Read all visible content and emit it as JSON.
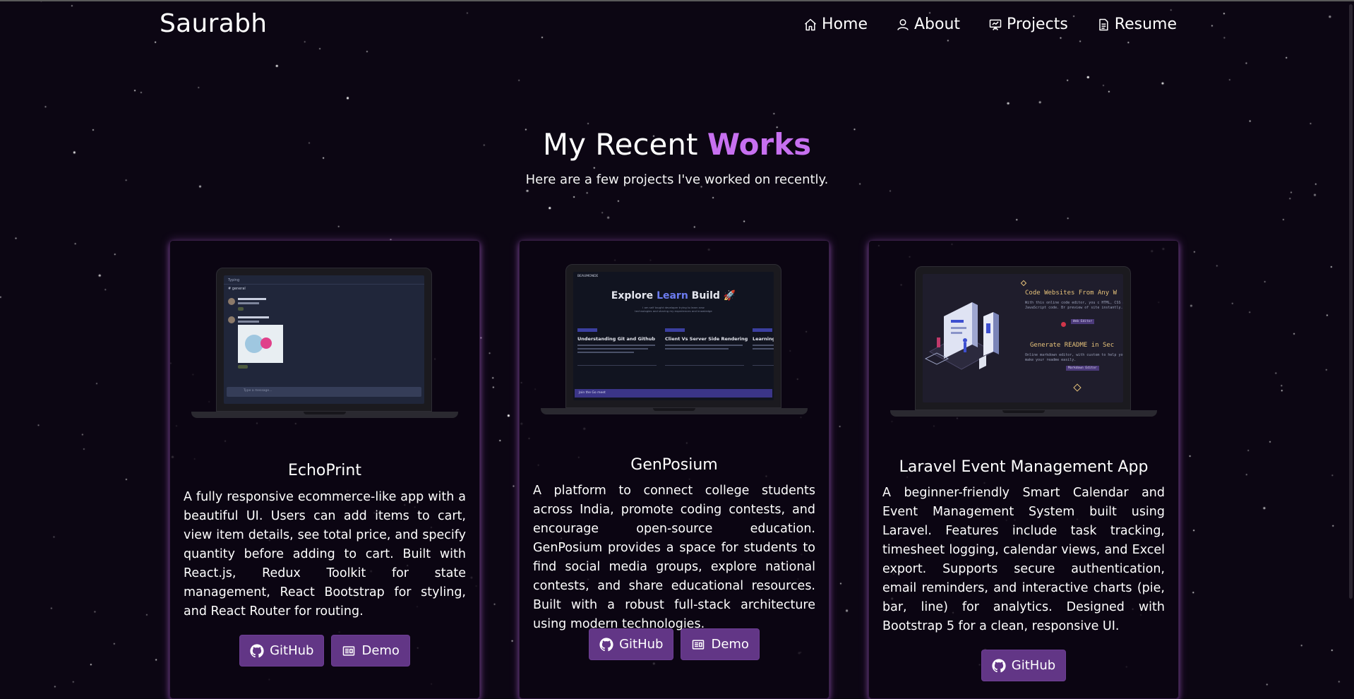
{
  "navbar": {
    "brand": "Saurabh",
    "links": [
      {
        "label": "Home",
        "icon": "home-icon"
      },
      {
        "label": "About",
        "icon": "user-icon"
      },
      {
        "label": "Projects",
        "icon": "projects-icon"
      },
      {
        "label": "Resume",
        "icon": "document-icon"
      }
    ]
  },
  "heading": {
    "prefix": "My Recent",
    "accent": "Works",
    "subtitle": "Here are a few projects I've worked on recently."
  },
  "colors": {
    "background": "#0c0613",
    "accent": "#c770f0",
    "button": "#623686"
  },
  "projects": [
    {
      "title": "EchoPrint",
      "description": "A fully responsive ecommerce-like app with a beautiful UI. Users can add items to cart, view item details, see total price, and specify quantity before adding to cart. Built with React.js, Redux Toolkit for state management, React Bootstrap for styling, and React Router for routing.",
      "buttons": {
        "github": "GitHub",
        "demo": "Demo"
      }
    },
    {
      "title": "GenPosium",
      "description": "A platform to connect college students across India, promote coding contests, and encourage open-source education. GenPosium provides a space for students to find social media groups, explore national contests, and share educational resources. Built with a robust full-stack architecture using modern technologies.",
      "buttons": {
        "github": "GitHub",
        "demo": "Demo"
      }
    },
    {
      "title": "Laravel Event Management App",
      "description": "A beginner-friendly Smart Calendar and Event Management System built using Laravel. Features include task tracking, timesheet logging, calendar views, and Excel export. Supports secure authentication, email reminders, and interactive charts (pie, bar, line) for analytics. Designed with Bootstrap 5 for a clean, responsive UI.",
      "buttons": {
        "github": "GitHub"
      }
    }
  ],
  "previews": {
    "echoprint": {
      "channel": "Typing",
      "room": "# general",
      "input": "Type a message..."
    },
    "genposium": {
      "brand": "BEAUMONDE",
      "hero_a": "Explore",
      "hero_b": "Learn",
      "hero_c": "Build",
      "hero_sub": "I am self taught developer trying to learn new technologies and sharing my experiences and knowledge",
      "posts": [
        "Understanding Git and Github",
        "Client Vs Server Side Rendering",
        "Learning Re"
      ],
      "banner": "Join the Go meet"
    },
    "laravel": {
      "line1": "Code Websites From Any W",
      "line1_sub": "With this online code editor, you c HTML, CSS and JavaScript code. Br preview of site instantly.",
      "btn1": "Web Editor",
      "line2": "Generate README in Sec",
      "line2_sub": "Online markdown editor, with custom to help you make your readme easily.",
      "btn2": "Markdown Editor"
    }
  }
}
